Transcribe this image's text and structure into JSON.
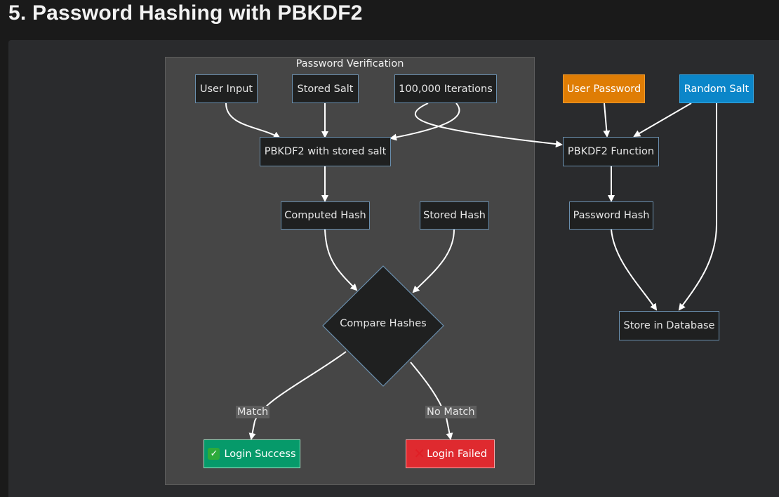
{
  "page": {
    "title": "5. Password Hashing with PBKDF2"
  },
  "diagram": {
    "cluster_label": "Password Verification",
    "nodes": {
      "user_input": "User Input",
      "stored_salt": "Stored Salt",
      "iterations": "100,000 Iterations",
      "pbkdf2_stored": "PBKDF2 with stored salt",
      "computed_hash": "Computed Hash",
      "stored_hash": "Stored Hash",
      "compare": "Compare Hashes",
      "login_success": "Login Success",
      "login_failed": "Login Failed",
      "user_password": "User Password",
      "random_salt": "Random Salt",
      "pbkdf2_function": "PBKDF2 Function",
      "password_hash": "Password Hash",
      "store_db": "Store in Database"
    },
    "edge_labels": {
      "match": "Match",
      "no_match": "No Match"
    },
    "icons": {
      "success": "check-mark-button-icon",
      "failed": "cross-mark-icon"
    },
    "colors": {
      "background": "#1a1a1a",
      "panel": "#2a2b2d",
      "cluster": "#464646",
      "node_fill": "#1f2020",
      "node_border": "#6a8fae",
      "user_password": "#df7d05",
      "random_salt": "#0b86c9",
      "login_success": "#069a6a",
      "login_failed": "#df2a2f"
    }
  }
}
